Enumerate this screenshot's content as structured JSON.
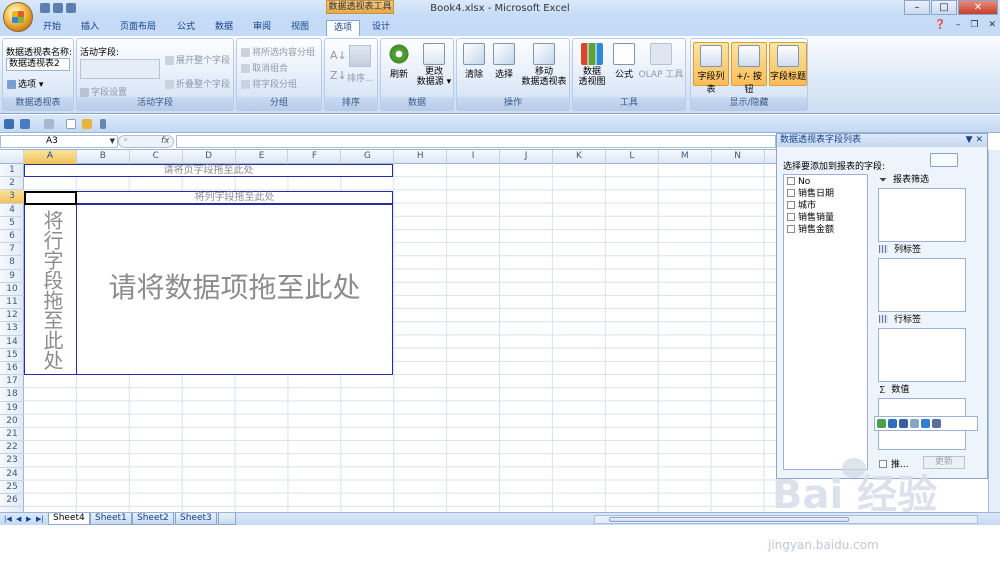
{
  "window": {
    "title": "Book4.xlsx - Microsoft Excel",
    "context_tab": "数据透视表工具",
    "controls": [
      "–",
      "□",
      "✕"
    ]
  },
  "tabs": [
    "开始",
    "插入",
    "页面布局",
    "公式",
    "数据",
    "审阅",
    "视图",
    "选项",
    "设计"
  ],
  "ribbon": {
    "g1": {
      "name_label": "数据透视表名称:",
      "name_value": "数据透视表2",
      "options": "选项 ▾",
      "title": "数据透视表"
    },
    "g2": {
      "active_label": "活动字段:",
      "field_settings": "字段设置",
      "expand": "展开整个字段",
      "collapse": "折叠整个字段",
      "title": "活动字段"
    },
    "g3": {
      "group_sel": "将所选内容分组",
      "ungroup": "取消组合",
      "group_field": "将字段分组",
      "title": "分组"
    },
    "g4": {
      "sort": "排序...",
      "title": "排序"
    },
    "g5": {
      "refresh": "刷新",
      "change_src": "更改\n数据源 ▾",
      "title": "数据"
    },
    "g6": {
      "clear": "清除",
      "select": "选择",
      "move": "移动\n数据透视表",
      "title": "操作"
    },
    "g7": {
      "chart": "数据\n透视图",
      "formula": "公式",
      "olap": "OLAP 工具",
      "title": "工具"
    },
    "g8": {
      "field_list": "字段列表",
      "buttons": "+/- 按钮",
      "headers": "字段标题",
      "title": "显示/隐藏"
    }
  },
  "namebox": "A3",
  "fx": "fx",
  "columns": [
    "A",
    "B",
    "C",
    "D",
    "E",
    "F",
    "G",
    "H",
    "I",
    "J",
    "K",
    "L",
    "M",
    "N"
  ],
  "rows": [
    "1",
    "2",
    "3",
    "4",
    "5",
    "6",
    "7",
    "8",
    "9",
    "10",
    "11",
    "12",
    "13",
    "14",
    "15",
    "16",
    "17",
    "18",
    "19",
    "20",
    "21",
    "22",
    "23",
    "24",
    "25",
    "26"
  ],
  "pivot": {
    "page_drop": "请将页字段拖至此处",
    "col_drop": "将列字段拖至此处",
    "row_drop": "将行字段拖至此处",
    "data_drop": "请将数据项拖至此处"
  },
  "sheets": [
    "Sheet4",
    "Sheet1",
    "Sheet2",
    "Sheet3"
  ],
  "panel": {
    "title": "数据透视表字段列表",
    "prompt": "选择要添加到报表的字段:",
    "fields": [
      "No",
      "销售日期",
      "城市",
      "销售销量",
      "销售金额"
    ],
    "areas": [
      "报表筛选",
      "列标签",
      "行标签",
      "数值"
    ],
    "defer": "推...",
    "update": "更新"
  },
  "watermark": {
    "brand": "Bai 经验",
    "url": "jingyan.baidu.com"
  }
}
